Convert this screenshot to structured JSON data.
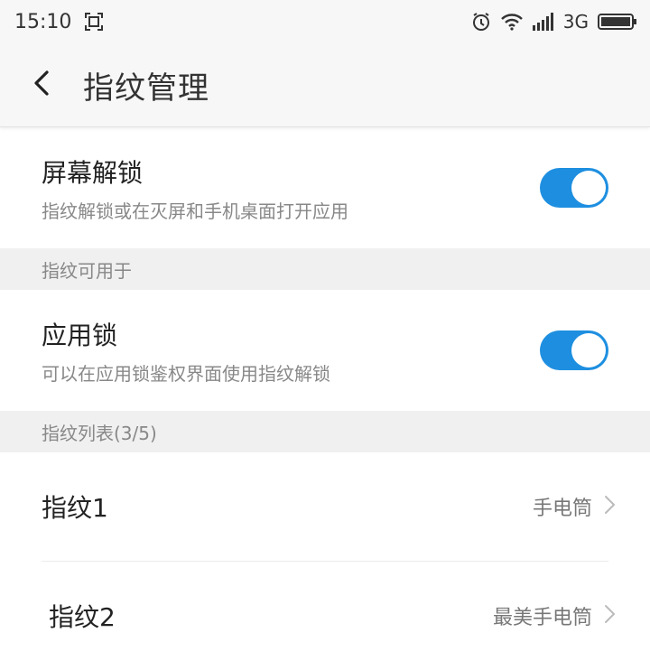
{
  "status_bar": {
    "time": "15:10",
    "network": "3G",
    "icons": [
      "screenshot-icon",
      "alarm-icon",
      "wifi-icon",
      "signal-icon",
      "battery-icon"
    ]
  },
  "app_bar": {
    "title": "指纹管理"
  },
  "screen_unlock": {
    "title": "屏幕解锁",
    "subtitle": "指纹解锁或在灭屏和手机桌面打开应用",
    "enabled": true
  },
  "section_usage": {
    "label": "指纹可用于"
  },
  "app_lock": {
    "title": "应用锁",
    "subtitle": "可以在应用锁鉴权界面使用指纹解锁",
    "enabled": true
  },
  "section_list": {
    "label": "指纹列表(3/5)"
  },
  "fingerprints": [
    {
      "name": "指纹1",
      "app": "手电筒"
    },
    {
      "name": "指纹2",
      "app": "最美手电筒"
    }
  ],
  "colors": {
    "accent": "#1e8fe0",
    "section_bg": "#f0f0f0",
    "bar_bg": "#f7f7f7"
  }
}
